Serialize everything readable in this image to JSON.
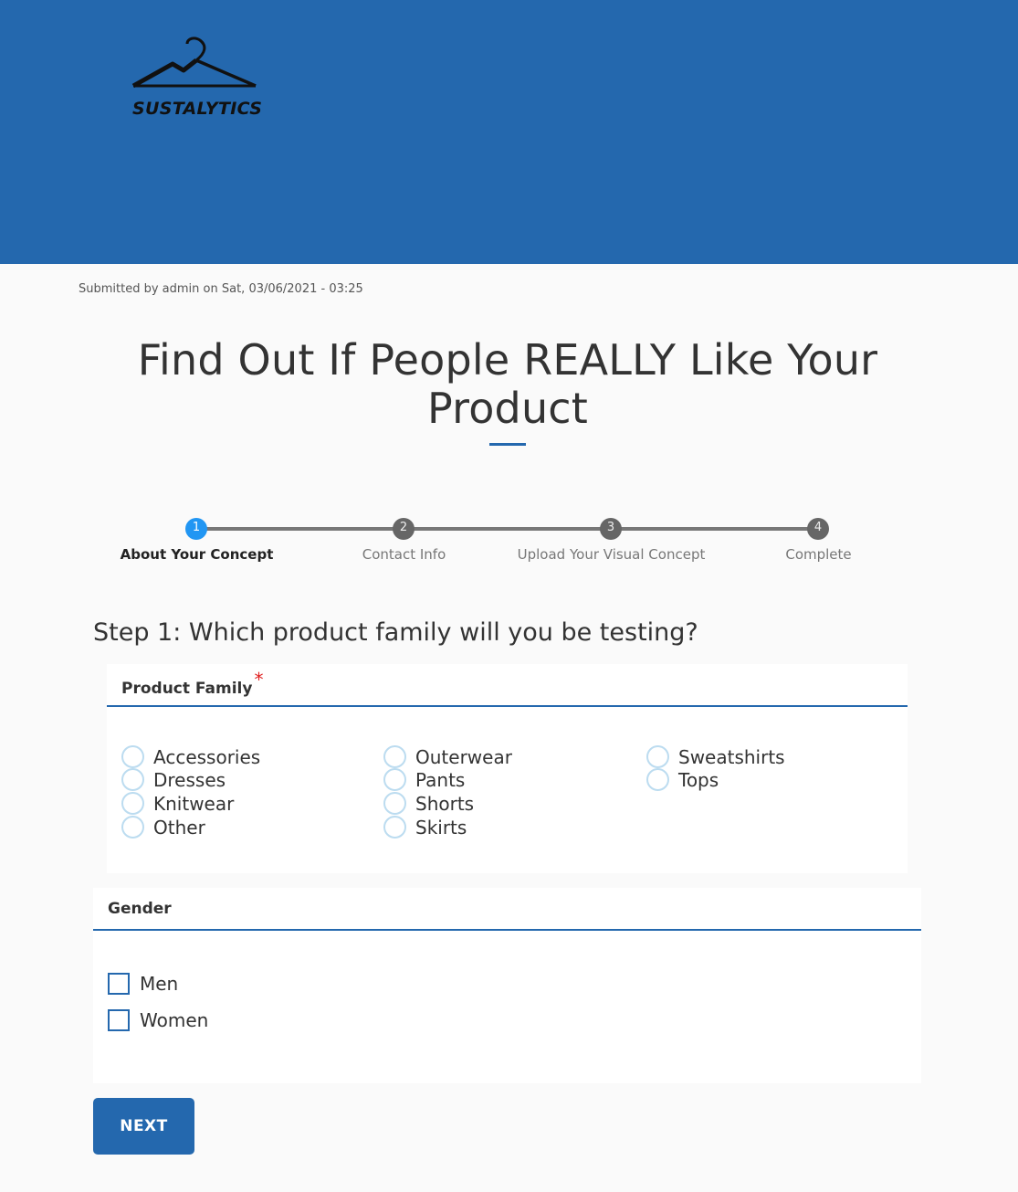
{
  "brand": {
    "name": "SUSTALYTICS",
    "header_color": "#2468ae"
  },
  "meta": {
    "submitted": "Submitted by admin on Sat, 03/06/2021 - 03:25"
  },
  "page_title": "Find Out If People REALLY Like Your Product",
  "progress": {
    "active_color": "#2196f3",
    "steps": [
      {
        "number": "1",
        "label": "About Your Concept",
        "active": true
      },
      {
        "number": "2",
        "label": "Contact Info",
        "active": false
      },
      {
        "number": "3",
        "label": "Upload Your Visual Concept",
        "active": false
      },
      {
        "number": "4",
        "label": "Complete",
        "active": false
      }
    ]
  },
  "step_heading": "Step 1: Which product family will you be testing?",
  "product_family": {
    "label": "Product Family",
    "required_mark": "*",
    "options": [
      "Accessories",
      "Dresses",
      "Knitwear",
      "Other",
      "Outerwear",
      "Pants",
      "Shorts",
      "Skirts",
      "Sweatshirts",
      "Tops"
    ]
  },
  "gender": {
    "label": "Gender",
    "options": [
      "Men",
      "Women"
    ]
  },
  "next_button": "NEXT"
}
